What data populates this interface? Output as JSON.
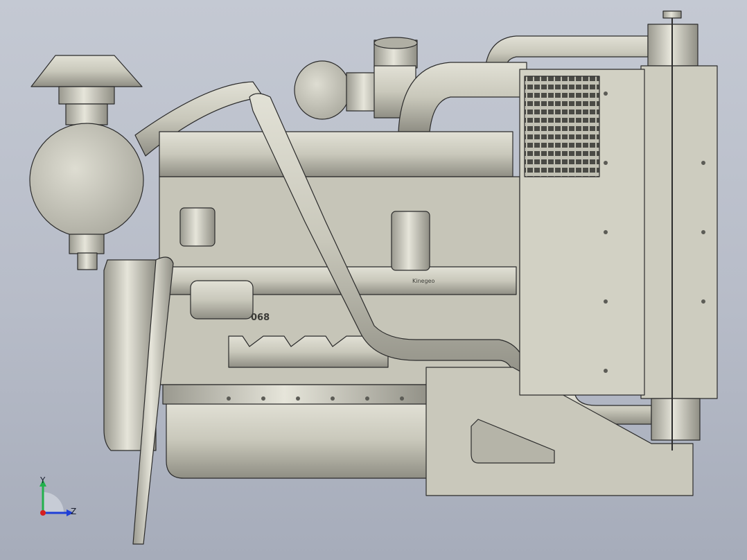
{
  "viewport": {
    "background_top": "#c4c9d3",
    "background_bottom": "#a6acba",
    "part_fill": "#c9c8bb",
    "part_shadow": "#8f8e84",
    "edge_color": "#2b2b2b"
  },
  "engine": {
    "block_text": "068",
    "label_text": "Kinegeo"
  },
  "triad": {
    "x_axis_color": "#d61f1f",
    "y_axis_color": "#22b14c",
    "z_axis_color": "#1f3fd6",
    "y_label": "Y",
    "z_label": "Z"
  }
}
